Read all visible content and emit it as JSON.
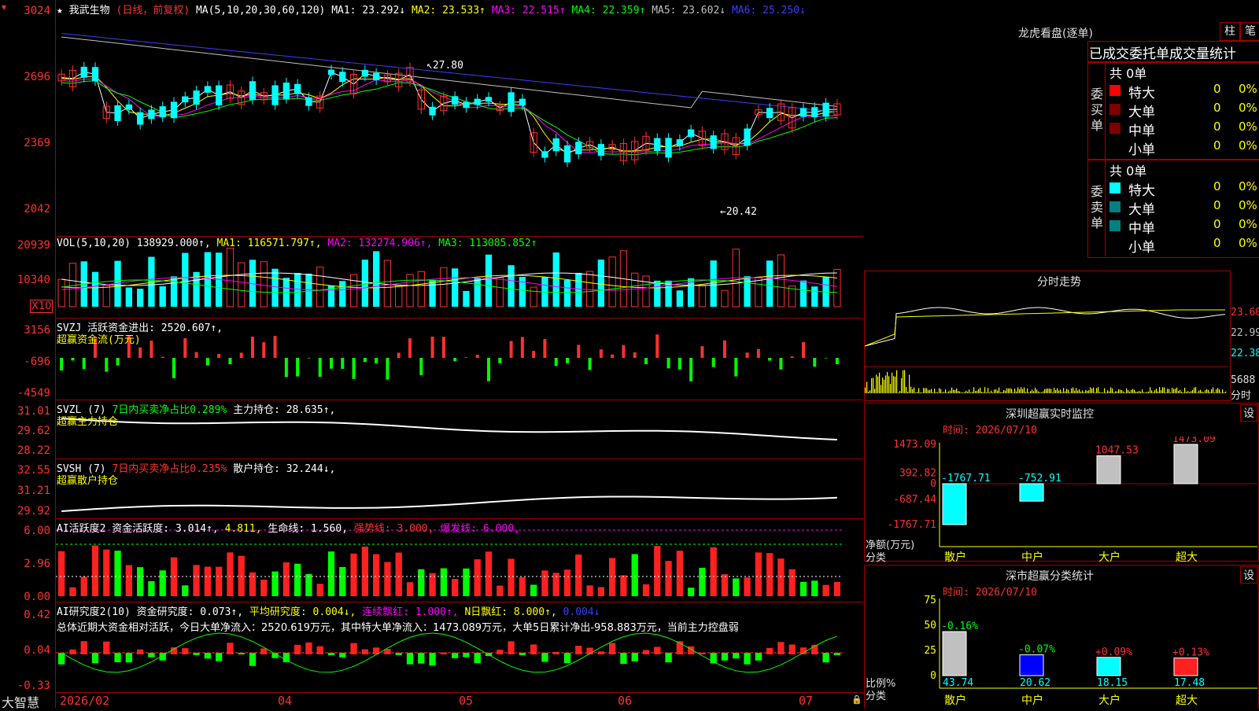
{
  "header": {
    "star": "★",
    "stock_name": "我武生物",
    "period": "(日线，前复权)",
    "ma_label": "MA(5,10,20,30,60,120)",
    "ma": [
      {
        "text": "MA1: 23.292↓",
        "color": "#ffffff"
      },
      {
        "text": "MA2: 23.533↑",
        "color": "#ffff00"
      },
      {
        "text": "MA3: 22.515↑",
        "color": "#ff00ff"
      },
      {
        "text": "MA4: 22.359↑",
        "color": "#00ff00"
      },
      {
        "text": "MA5: 23.602↓",
        "color": "#c0c0c0"
      },
      {
        "text": "MA6: 25.250↓",
        "color": "#3c3cff"
      }
    ]
  },
  "price_axis": [
    "3024",
    "2696",
    "2369",
    "2042"
  ],
  "price_annotations": {
    "high": "27.80",
    "low": "20.42"
  },
  "vol_panel": {
    "header": "VOL(5,10,20)",
    "values": [
      {
        "text": "138929.000↑,",
        "color": "#ffffff"
      },
      {
        "text": "MA1: 116571.797↑,",
        "color": "#ffff00"
      },
      {
        "text": "MA2: 132274.906↑,",
        "color": "#ff00ff"
      },
      {
        "text": "MA3: 113085.852↑",
        "color": "#00ff00"
      }
    ],
    "axis": [
      "20939",
      "10340"
    ],
    "unit": "X10"
  },
  "flow_panel": {
    "line1": "SVZJ  活跃资金进出: 2520.607↑,",
    "line2": "超赢资金流(万元)",
    "axis": [
      "3156",
      "-696",
      "-4549"
    ]
  },
  "svzl_panel": {
    "prefix": "SVZL (7)",
    "green": "7日内买卖净占比0.289%",
    "white": "主力持仓: 28.635↑,",
    "line2": "超赢主力持仓",
    "axis": [
      "31.01",
      "29.62",
      "28.22"
    ]
  },
  "svsh_panel": {
    "prefix": "SVSH (7)",
    "red": "7日内买卖净占比0.235%",
    "white": "散户持仓: 32.244↓,",
    "line2": "超赢散户持仓",
    "axis": [
      "32.55",
      "31.21",
      "29.92"
    ]
  },
  "ai1_panel": {
    "segments": [
      {
        "text": "AI活跃度2 资金活跃度: 3.014↑,",
        "color": "#ffffff"
      },
      {
        "text": "4.811,",
        "color": "#ffff00"
      },
      {
        "text": "生命线: 1.560,",
        "color": "#ffffff"
      },
      {
        "text": "强势线: 3.000,",
        "color": "#ff3030"
      },
      {
        "text": "爆发线: 6.000,",
        "color": "#ff00ff"
      }
    ],
    "axis": [
      "6.00",
      "2.96",
      "0.00"
    ]
  },
  "ai2_panel": {
    "segments": [
      {
        "text": "AI研究度2(10) 资金研究度: 0.073↑,",
        "color": "#ffffff"
      },
      {
        "text": "平均研究度: 0.004↓,",
        "color": "#ffff00"
      },
      {
        "text": "连续飘红: 1.000↑,",
        "color": "#ff00ff"
      },
      {
        "text": "N日飘红: 8.000↑,",
        "color": "#ffff00"
      },
      {
        "text": "0.004↓",
        "color": "#3c3cff"
      }
    ],
    "summary": "总体近期大资金相对活跃，今日大单净流入：2520.619万元，其中特大单净流入：1473.089万元，大单5日累计净出-958.883万元，当前主力控盘弱",
    "axis": [
      "0.42",
      "0.04",
      "-0.33"
    ]
  },
  "x_axis": {
    "labels": [
      "2026/02",
      "04",
      "05",
      "06",
      "07"
    ]
  },
  "brand": "大智慧",
  "right": {
    "lhb_title": "龙虎看盘(逐单)",
    "btn_zhu": "柱",
    "btn_bi": "笔",
    "stat_title": "已成交委托单成交量统计",
    "buy_label": "委买单",
    "sell_label": "委卖单",
    "buy_total": "共 0单",
    "sell_total": "共 0单",
    "buy_rows": [
      {
        "name": "特大",
        "v": "0",
        "p": "0%",
        "color": "#ff0000"
      },
      {
        "name": "大单",
        "v": "0",
        "p": "0%",
        "color": "#800000"
      },
      {
        "name": "中单",
        "v": "0",
        "p": "0%",
        "color": "#800000"
      },
      {
        "name": "小单",
        "v": "0",
        "p": "0%",
        "color": ""
      }
    ],
    "sell_rows": [
      {
        "name": "特大",
        "v": "0",
        "p": "0%",
        "color": "#00ffff"
      },
      {
        "name": "大单",
        "v": "0",
        "p": "0%",
        "color": "#008080"
      },
      {
        "name": "中单",
        "v": "0",
        "p": "0%",
        "color": "#008080"
      },
      {
        "name": "小单",
        "v": "0",
        "p": "0%",
        "color": ""
      }
    ],
    "intraday_title": "分时走势",
    "intraday_axis": [
      "23.60",
      "22.99",
      "22.38"
    ],
    "intraday_vol": "5688",
    "intraday_unit": "分时",
    "sz_title": "深圳超赢实时监控",
    "sz_time": "时间: 2026/07/10",
    "set1": "设",
    "set2": "设",
    "sz_axis": [
      "1473.09",
      "392.82",
      "0",
      "-687.44",
      "-1767.71"
    ],
    "sz_ylabel1": "净额(万元)",
    "sz_ylabel2": "分类",
    "sz_cats": [
      "散户",
      "中户",
      "大户",
      "超大"
    ],
    "sz_values": [
      "-1767.71",
      "-752.91",
      "1047.53",
      "1473.09"
    ],
    "sh_title": "深市超赢分类统计",
    "sh_time": "时间: 2026/07/10",
    "sh_axis": [
      "75",
      "50",
      "25",
      "0"
    ],
    "sh_ylabel1": "比例%",
    "sh_ylabel2": "分类",
    "sh_cats": [
      "散户",
      "中户",
      "大户",
      "超大"
    ],
    "sh_tops": [
      "-0.16%",
      "-0.07%",
      "+0.09%",
      "+0.13%"
    ],
    "sh_bottoms": [
      "43.74",
      "20.62",
      "18.15",
      "17.48"
    ]
  },
  "chart_data": [
    {
      "type": "bar",
      "title": "深圳超赢实时监控",
      "categories": [
        "散户",
        "中户",
        "大户",
        "超大"
      ],
      "values": [
        -1767.71,
        -752.91,
        1047.53,
        1473.09
      ],
      "ylabel": "净额(万元)",
      "xlabel": "分类",
      "ylim": [
        -1767.71,
        1473.09
      ]
    },
    {
      "type": "bar",
      "title": "深市超赢分类统计",
      "categories": [
        "散户",
        "中户",
        "大户",
        "超大"
      ],
      "values": [
        43.74,
        20.62,
        18.15,
        17.48
      ],
      "ylabel": "比例%",
      "xlabel": "分类",
      "ylim": [
        0,
        75
      ]
    }
  ]
}
